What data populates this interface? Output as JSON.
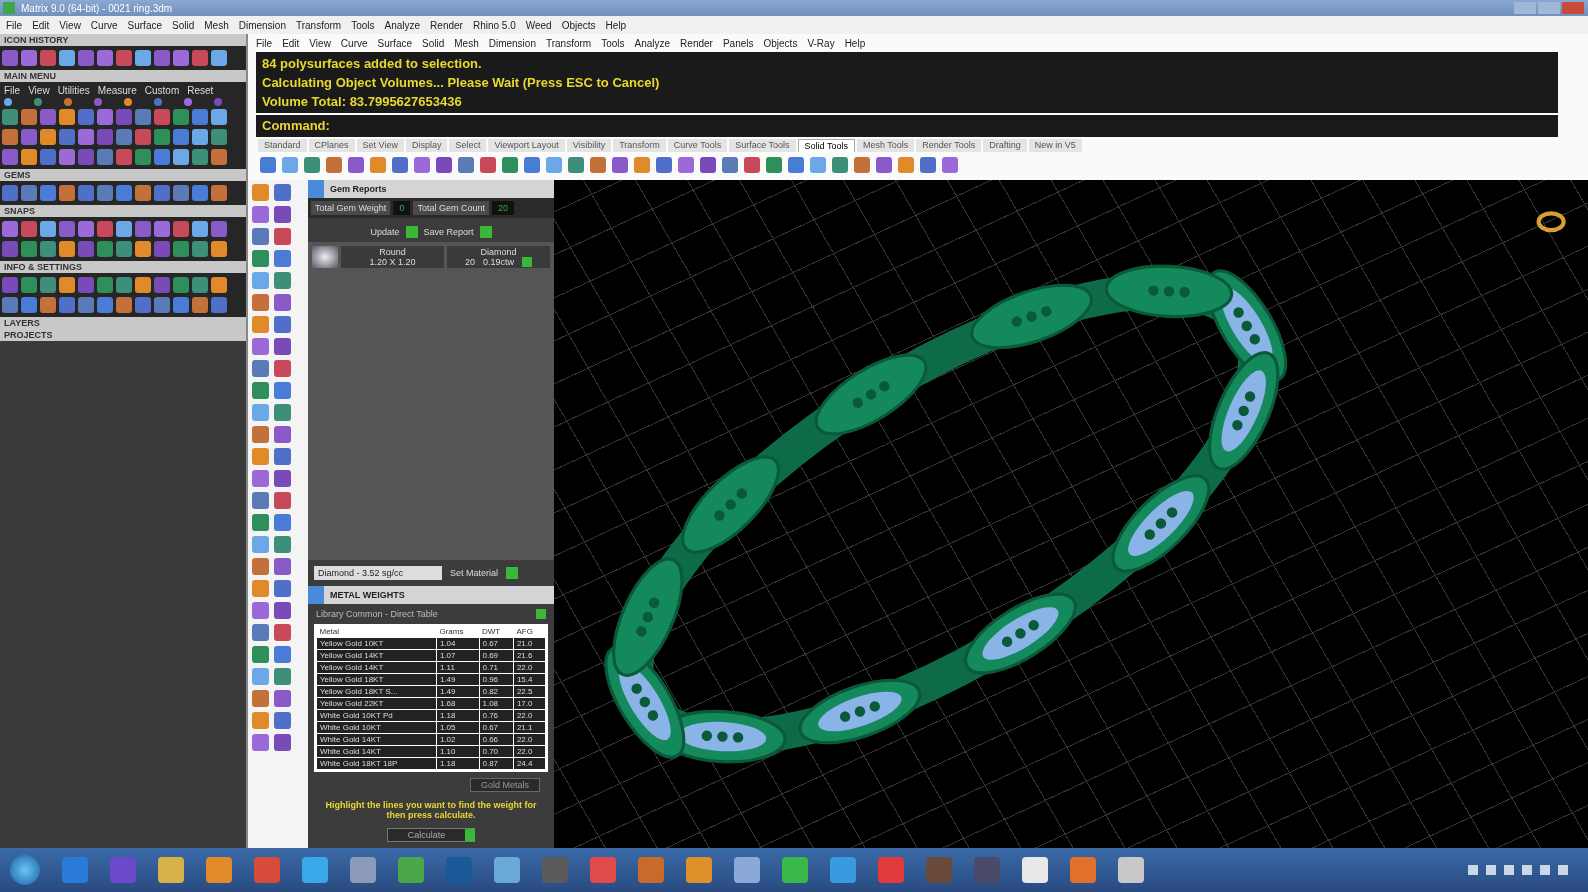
{
  "window": {
    "title": "Matrix 9.0 (64-bit) - 0021 ring.3dm"
  },
  "app_menu": [
    "File",
    "Edit",
    "View",
    "Curve",
    "Surface",
    "Solid",
    "Mesh",
    "Dimension",
    "Transform",
    "Tools",
    "Analyze",
    "Render",
    "Rhino 5.0",
    "Weed",
    "Objects",
    "Help"
  ],
  "left_panel": {
    "sections": [
      {
        "title": "ICON HISTORY",
        "kind": "icon_row"
      },
      {
        "title": "MAIN MENU",
        "kind": "menu",
        "items": [
          "File",
          "View",
          "Utilities",
          "Measure",
          "Custom",
          "Reset"
        ]
      },
      {
        "title": "GEMS",
        "kind": "icon_row"
      },
      {
        "title": "SNAPS",
        "kind": "icon_grid"
      },
      {
        "title": "INFO & SETTINGS",
        "kind": "icon_grid"
      },
      {
        "title": "LAYERS",
        "kind": "header"
      },
      {
        "title": "PROJECTS",
        "kind": "header"
      }
    ]
  },
  "rhino_menu": [
    "File",
    "Edit",
    "View",
    "Curve",
    "Surface",
    "Solid",
    "Mesh",
    "Dimension",
    "Transform",
    "Tools",
    "Analyze",
    "Render",
    "Panels",
    "Objects",
    "V-Ray",
    "Help"
  ],
  "command_history": [
    "84 polysurfaces added to selection.",
    "Calculating Object Volumes... Please Wait (Press ESC to Cancel)",
    "Volume Total: 83.7995627653436"
  ],
  "command_prompt": "Command:",
  "toolbar_tabs": [
    {
      "label": "Standard",
      "selected": false
    },
    {
      "label": "CPlanes",
      "selected": false
    },
    {
      "label": "Set View",
      "selected": false
    },
    {
      "label": "Display",
      "selected": false
    },
    {
      "label": "Select",
      "selected": false
    },
    {
      "label": "Viewport Layout",
      "selected": false
    },
    {
      "label": "Visibility",
      "selected": false
    },
    {
      "label": "Transform",
      "selected": false
    },
    {
      "label": "Curve Tools",
      "selected": false
    },
    {
      "label": "Surface Tools",
      "selected": false
    },
    {
      "label": "Solid Tools",
      "selected": true
    },
    {
      "label": "Mesh Tools",
      "selected": false
    },
    {
      "label": "Render Tools",
      "selected": false
    },
    {
      "label": "Drafting",
      "selected": false
    },
    {
      "label": "New in V5",
      "selected": false
    }
  ],
  "gem_report": {
    "title": "Gem Reports",
    "total_weight_label": "Total Gem Weight",
    "total_weight": "0",
    "total_count_label": "Total Gem Count",
    "total_count": "20",
    "update_label": "Update",
    "save_label": "Save Report",
    "gems": [
      {
        "shape": "Round",
        "size": "1.20 X 1.20",
        "material": "Diamond",
        "count": "20",
        "weight": "0.19ctw"
      }
    ],
    "material_select": "Diamond - 3.52 sg/cc",
    "set_material_label": "Set Material"
  },
  "metal_weights": {
    "title": "METAL WEIGHTS",
    "library": "Library Common - Direct Table",
    "columns": [
      "Metal",
      "Grams",
      "DWT",
      "AFG"
    ],
    "rows": [
      [
        "Yellow Gold 10KT",
        "1.04",
        "0.67",
        "21.0"
      ],
      [
        "Yellow Gold 14KT",
        "1.07",
        "0.69",
        "21.6"
      ],
      [
        "Yellow Gold 14KT",
        "1.11",
        "0.71",
        "22.0"
      ],
      [
        "Yellow Gold 18KT",
        "1.49",
        "0.96",
        "15.4"
      ],
      [
        "Yellow Gold 18KT S...",
        "1.49",
        "0.82",
        "22.5"
      ],
      [
        "Yellow Gold 22KT",
        "1.68",
        "1.08",
        "17.0"
      ],
      [
        "White Gold 10KT Pd",
        "1.18",
        "0.76",
        "22.0"
      ],
      [
        "White Gold 10KT",
        "1.05",
        "0.67",
        "21.1"
      ],
      [
        "White Gold 14KT",
        "1.02",
        "0.66",
        "22.0"
      ],
      [
        "White Gold 14KT",
        "1.10",
        "0.70",
        "22.0"
      ],
      [
        "White Gold 18KT 18P",
        "1.18",
        "0.87",
        "24.4"
      ]
    ],
    "filter": "Gold Metals",
    "hint": "Highlight the lines you want to find the weight for then press calculate.",
    "calculate_label": "Calculate"
  }
}
